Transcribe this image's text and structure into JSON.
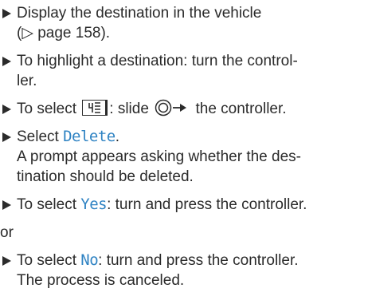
{
  "steps": [
    {
      "line1": "Display the destination in the vehicle",
      "line2": "(▷ page 158)."
    },
    {
      "line1": "To highlight a destination: turn the control-",
      "line2": "ler."
    },
    {
      "prefix": "To select",
      "middle": ": slide",
      "suffix": "the controller.",
      "menu_icon": "menu-list-icon",
      "controller_icon": "controller-slide-right-icon"
    },
    {
      "prefix": "Select",
      "option": "Delete",
      "suffix": ".",
      "line2": "A prompt appears asking whether the des-",
      "line3": "tination should be deleted."
    },
    {
      "prefix": "To select",
      "option": "Yes",
      "suffix": ": turn and press the controller."
    },
    {
      "prefix": "To select",
      "option": "No",
      "suffix": ": turn and press the controller.",
      "line2": "The process is canceled."
    }
  ],
  "or_label": "or",
  "colors": {
    "text": "#2b2b2b",
    "option_blue": "#2f83c3"
  }
}
